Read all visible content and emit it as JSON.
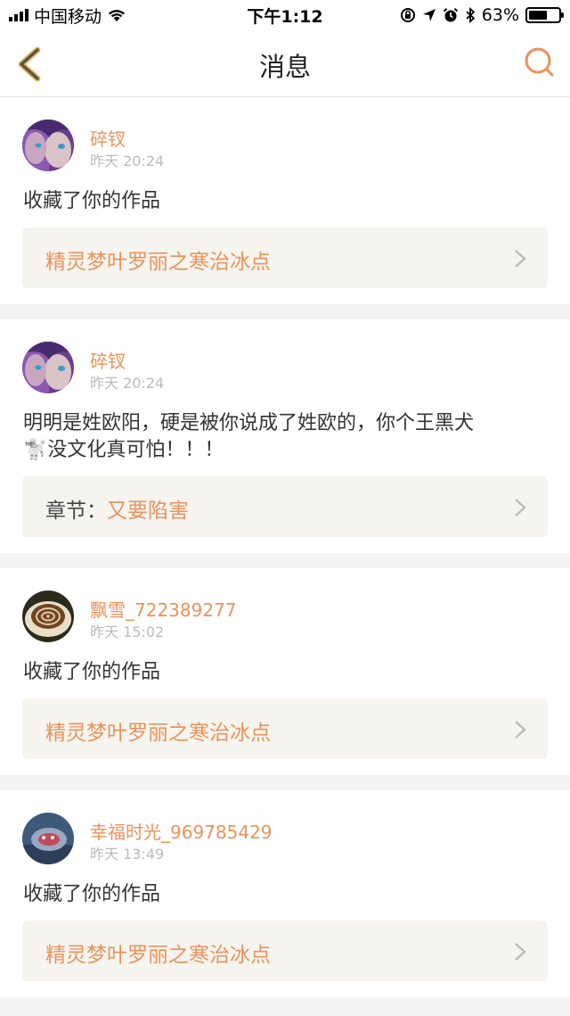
{
  "status_bar": {
    "carrier": "中国移动",
    "time": "下午1:12",
    "battery": "63%",
    "battery_level": 0.63
  },
  "nav": {
    "title": "消息",
    "back_icon": "chevron-left-icon",
    "search_icon": "search-icon",
    "accent_color": "#e8935c"
  },
  "messages": [
    {
      "username": "碎钗",
      "time": "昨天 20:24",
      "text": "收藏了你的作品",
      "link_prefix": "",
      "link_value": "精灵梦叶罗丽之寒治冰点"
    },
    {
      "username": "碎钗",
      "time": "昨天 20:24",
      "text": "明明是姓欧阳，硬是被你说成了姓欧的，你个王黑犬",
      "text_line2": "没文化真可怕！！！",
      "emoji": "🐩",
      "link_prefix": "章节：",
      "link_value": "又要陷害"
    },
    {
      "username": "飘雪_722389277",
      "time": "昨天 15:02",
      "text": "收藏了你的作品",
      "link_prefix": "",
      "link_value": "精灵梦叶罗丽之寒治冰点"
    },
    {
      "username": "幸福时光_969785429",
      "time": "昨天 13:49",
      "text": "收藏了你的作品",
      "link_prefix": "",
      "link_value": "精灵梦叶罗丽之寒治冰点"
    }
  ]
}
